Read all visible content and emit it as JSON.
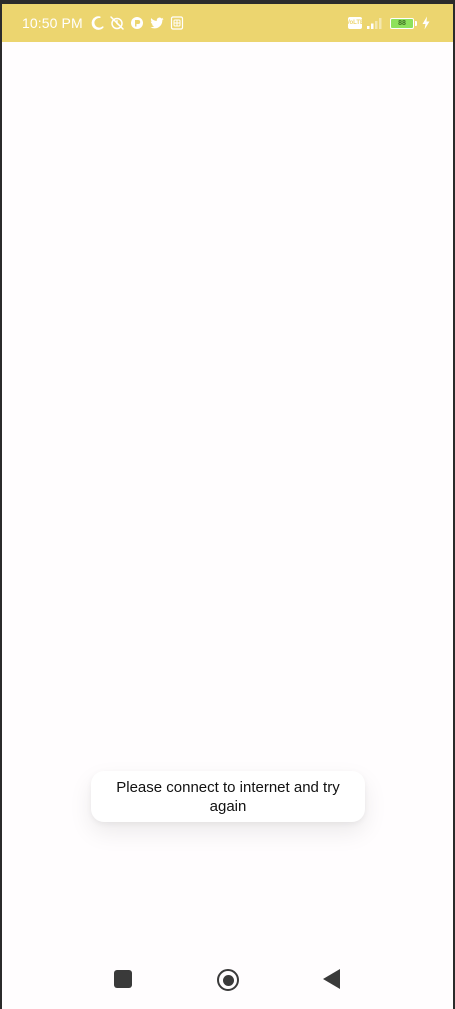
{
  "status_bar": {
    "time": "10:50 PM",
    "battery_level": "88",
    "network_badge": "VoLTE",
    "icons_left": [
      "moon-icon",
      "no-alarm-icon",
      "app-icon",
      "twitter-icon",
      "sim-card-icon"
    ],
    "icons_right": [
      "volte-icon",
      "signal-icon",
      "battery-icon",
      "charging-icon"
    ],
    "colors": {
      "background": "#ecd56f",
      "foreground": "#ffffff",
      "battery_fill": "#8ee15c"
    }
  },
  "content": {
    "background": "#fffdfe"
  },
  "toast": {
    "message": "Please connect to internet and try again"
  },
  "navigation_bar": {
    "buttons": [
      "recents-button",
      "home-button",
      "back-button"
    ],
    "icon_color": "#3a3a3a"
  }
}
